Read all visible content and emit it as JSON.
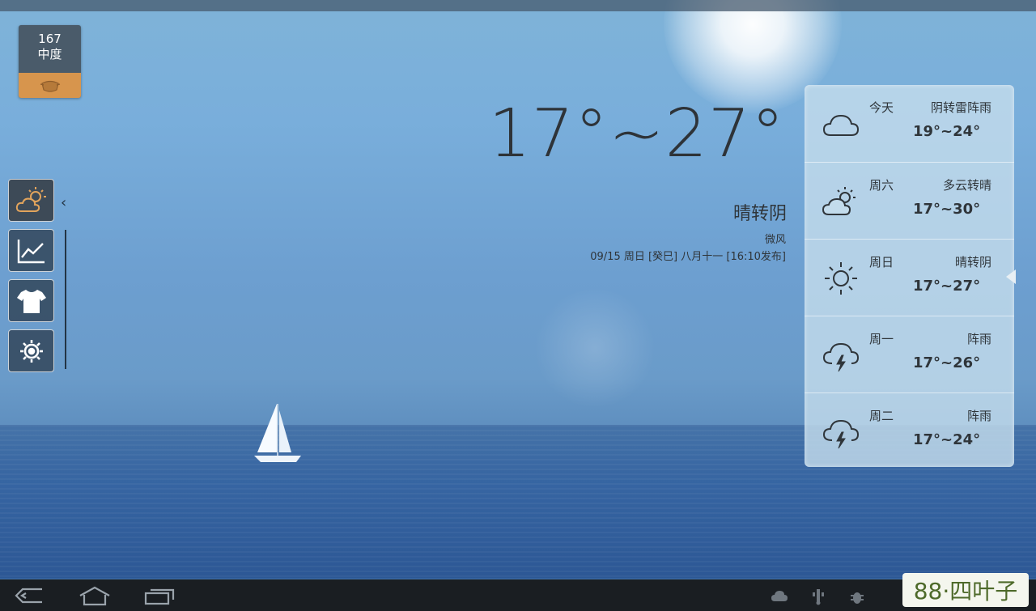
{
  "aqi": {
    "value": "167",
    "level": "中度"
  },
  "current": {
    "temp_range": "17°~27°",
    "condition": "晴转阴",
    "wind": "微风",
    "date_info": "09/15 周日  [癸巳] 八月十一   [16:10发布]"
  },
  "forecast": [
    {
      "day": "今天",
      "condition": "阴转雷阵雨",
      "temp": "19°~24°",
      "icon": "cloud-icon"
    },
    {
      "day": "周六",
      "condition": "多云转晴",
      "temp": "17°~30°",
      "icon": "partly-cloudy-icon"
    },
    {
      "day": "周日",
      "condition": "晴转阴",
      "temp": "17°~27°",
      "icon": "sun-icon"
    },
    {
      "day": "周一",
      "condition": "阵雨",
      "temp": "17°~26°",
      "icon": "thunderstorm-icon"
    },
    {
      "day": "周二",
      "condition": "阵雨",
      "temp": "17°~24°",
      "icon": "thunderstorm-icon"
    }
  ],
  "side_menu": [
    {
      "name": "weather",
      "icon": "partly-cloudy-icon",
      "active": true
    },
    {
      "name": "trend",
      "icon": "line-chart-icon",
      "active": false
    },
    {
      "name": "clothing",
      "icon": "tshirt-icon",
      "active": false
    },
    {
      "name": "settings",
      "icon": "gear-icon",
      "active": false
    }
  ],
  "watermark": "88·四叶子",
  "colors": {
    "accent": "#d7954d",
    "panel": "#c3dcec",
    "text": "#2f353a",
    "nav_bg": "#1a1e22"
  }
}
